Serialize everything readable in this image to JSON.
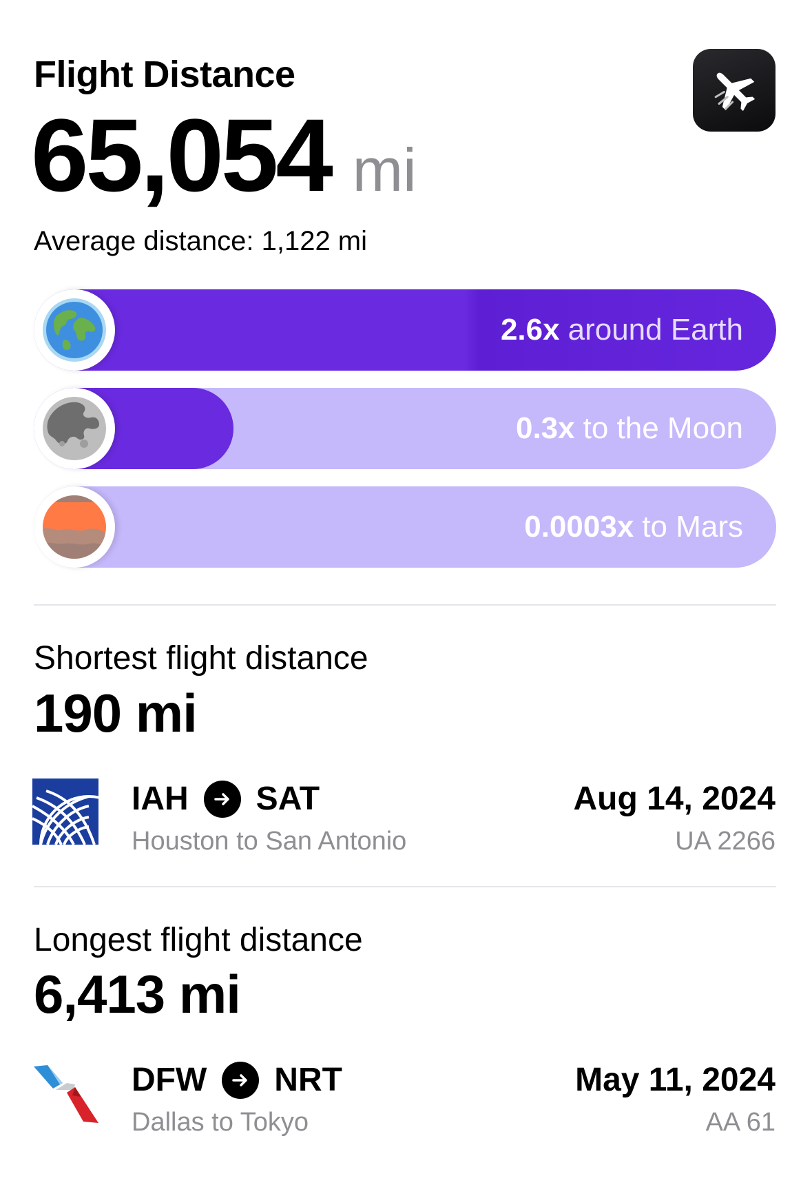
{
  "header": {
    "title": "Flight Distance",
    "total_distance": "65,054",
    "unit": "mi",
    "average": "Average distance: 1,122 mi",
    "app_icon": "airplane-icon"
  },
  "comparisons": [
    {
      "planet": "earth-icon",
      "multiplier": "2.6x",
      "text": "around Earth",
      "progress": 1.0,
      "fill_color": "#6a2ae0",
      "track_color": "#c5b8fb"
    },
    {
      "planet": "moon-icon",
      "multiplier": "0.3x",
      "text": "to the Moon",
      "progress": 0.27,
      "fill_color": "#6a2ae0",
      "track_color": "#c5b8fb"
    },
    {
      "planet": "mars-icon",
      "multiplier": "0.0003x",
      "text": "to Mars",
      "progress": 0.0003,
      "fill_color": "#6a2ae0",
      "track_color": "#c5b8fb"
    }
  ],
  "shortest": {
    "label": "Shortest flight distance",
    "value": "190 mi",
    "airline_logo": "united-airlines-logo",
    "from": "IAH",
    "to": "SAT",
    "cities": "Houston to San Antonio",
    "date": "Aug 14, 2024",
    "flight": "UA 2266"
  },
  "longest": {
    "label": "Longest flight distance",
    "value": "6,413 mi",
    "airline_logo": "american-airlines-logo",
    "from": "DFW",
    "to": "NRT",
    "cities": "Dallas to Tokyo",
    "date": "May 11, 2024",
    "flight": "AA 61"
  },
  "colors": {
    "accent": "#6a2ae0",
    "track": "#c5b8fb",
    "secondary_text": "#8e8e93"
  }
}
